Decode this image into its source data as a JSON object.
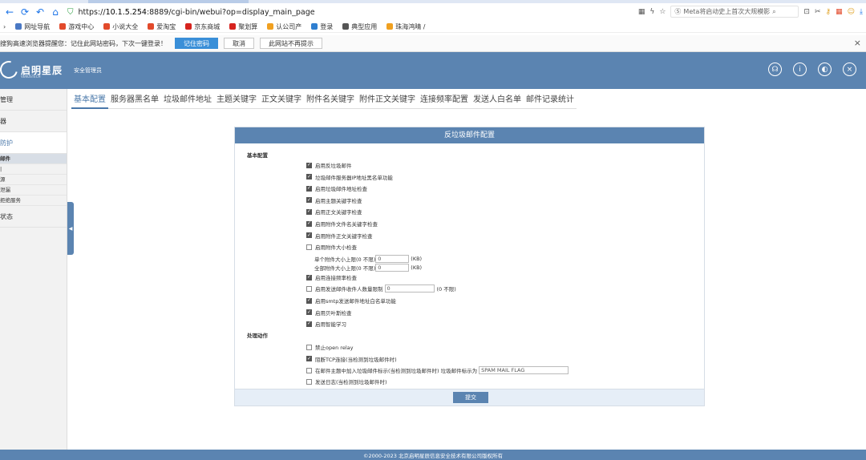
{
  "browser": {
    "url_prefix": "https://",
    "url_host": "10.1.5.254",
    "url_rest": ":8889/cgi-bin/webui?op=display_main_page",
    "search_placeholder": "Meta将启动史上首次大规模影",
    "bookmarks": [
      "网址导航",
      "游戏中心",
      "小说大全",
      "爱淘宝",
      "京东商城",
      "聚划算",
      "认公司产",
      "登录",
      "典型应用",
      "珠海鸿晴 /"
    ],
    "bookmark_colors": [
      "#4a78c4",
      "#e24a2b",
      "#e24a2b",
      "#e24a2b",
      "#d6231e",
      "#d6231e",
      "#f0a020",
      "#2f7fd0",
      "#555555",
      "#f0a020"
    ]
  },
  "password_bar": {
    "message": "搜狗高速浏览器提醒您：记住此网站密码，下次一键登录！",
    "remember": "记住密码",
    "cancel": "取消",
    "never": "此网站不再提示",
    "close": "×"
  },
  "header": {
    "logo_name": "启明星辰",
    "logo_sub": "VENUSTECH",
    "module": "安全管理员"
  },
  "sidebar": {
    "items": [
      {
        "label": "管理",
        "type": "item"
      },
      {
        "label": "器",
        "type": "item"
      },
      {
        "label": "防护",
        "type": "active"
      },
      {
        "label": "邮件",
        "type": "head"
      },
      {
        "label": "|",
        "type": "sub"
      },
      {
        "label": "源",
        "type": "sub"
      },
      {
        "label": "泄漏",
        "type": "sub"
      },
      {
        "label": "拒绝服务",
        "type": "sub"
      },
      {
        "label": "状态",
        "type": "item"
      }
    ]
  },
  "tabs": [
    "基本配置",
    "服务器黑名单",
    "垃圾邮件地址",
    "主题关键字",
    "正文关键字",
    "附件名关键字",
    "附件正文关键字",
    "连接频率配置",
    "发送人白名单",
    "邮件记录统计"
  ],
  "form": {
    "title": "反垃圾邮件配置",
    "section_basic": "基本配置",
    "options": [
      {
        "label": "启用反垃圾邮件",
        "checked": true
      },
      {
        "label": "垃圾邮件服务器IP地址黑名单功能",
        "checked": true
      },
      {
        "label": "启用垃圾邮件地址检查",
        "checked": true
      },
      {
        "label": "启用主题关键字检查",
        "checked": true
      },
      {
        "label": "启用正文关键字检查",
        "checked": true
      },
      {
        "label": "启用附件文件名关键字检查",
        "checked": true
      },
      {
        "label": "启用附件正文关键字检查",
        "checked": true
      },
      {
        "label": "启用附件大小检查",
        "checked": false
      }
    ],
    "single_attach": {
      "label": "单个附件大小上限(0 不限)",
      "value": "0",
      "unit": "(KB)"
    },
    "total_attach": {
      "label": "全部附件大小上限(0 不限)",
      "value": "0",
      "unit": "(KB)"
    },
    "freq_check": {
      "label": "启用连接频率检查",
      "checked": true
    },
    "recipient_limit": {
      "label": "启用发送邮件收件人数量限制",
      "checked": false,
      "value": "0",
      "hint": "(0 不限)"
    },
    "options2": [
      {
        "label": "启用smtp发送邮件地址白名单功能",
        "checked": true
      },
      {
        "label": "启用贝叶斯检查",
        "checked": true
      },
      {
        "label": "启用智能学习",
        "checked": true
      }
    ],
    "section_action": "处理动作",
    "actions": [
      {
        "label": "禁止open relay",
        "checked": false
      },
      {
        "label": "阻断TCP连接(当检测到垃圾邮件时)",
        "checked": true
      }
    ],
    "flag_action": {
      "label": "在邮件主题中加入垃圾邮件标示(当检测到垃圾邮件时) 垃圾邮件标示为",
      "checked": false,
      "value": "SPAM MAIL FLAG"
    },
    "log_action": {
      "label": "发送日志(当检测到垃圾邮件时)",
      "checked": false
    },
    "submit": "提交"
  },
  "footer": "©2000-2023 北京启明星辰信息安全技术有限公司版权所有"
}
